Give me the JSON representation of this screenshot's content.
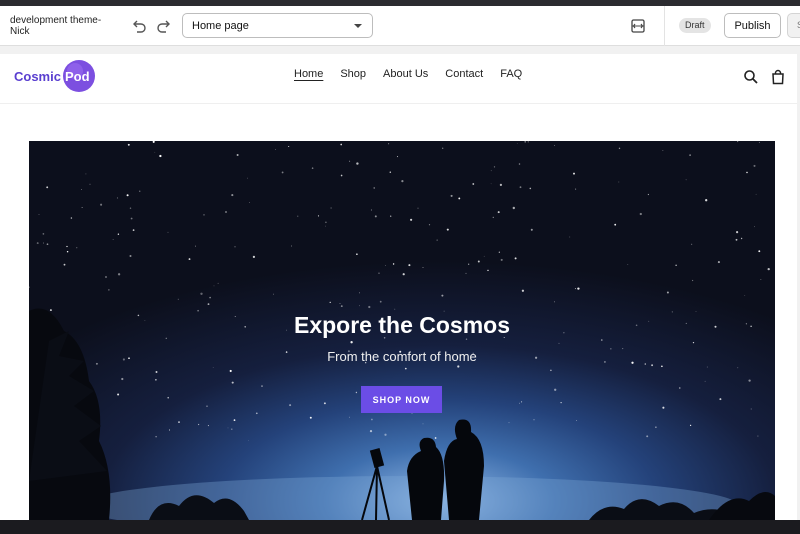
{
  "editor": {
    "theme_name": "development theme-Nick",
    "page_select": {
      "value": "Home page"
    },
    "status_badge": "Draft",
    "publish_label": "Publish",
    "more_label": "S"
  },
  "store": {
    "logo": {
      "part1": "Cosmic",
      "part2": "Pod"
    },
    "nav": [
      {
        "label": "Home",
        "active": true
      },
      {
        "label": "Shop"
      },
      {
        "label": "About Us"
      },
      {
        "label": "Contact"
      },
      {
        "label": "FAQ"
      }
    ],
    "hero": {
      "title": "Expore the Cosmos",
      "subtitle": "From the comfort of home",
      "button": "SHOP NOW"
    }
  },
  "colors": {
    "brand_purple": "#6b4de6",
    "logo_text": "#5a3fd0"
  },
  "icons": [
    "undo-icon",
    "redo-icon",
    "chevron-down-icon",
    "viewport-icon",
    "search-icon",
    "bag-icon"
  ]
}
